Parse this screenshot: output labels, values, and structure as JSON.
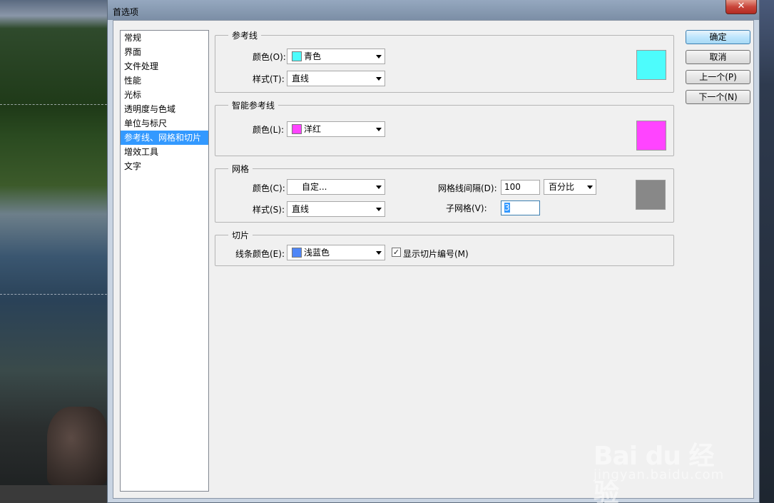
{
  "window": {
    "title": "首选项",
    "close_label": "✕"
  },
  "nav": {
    "items": [
      "常规",
      "界面",
      "文件处理",
      "性能",
      "光标",
      "透明度与色域",
      "单位与标尺",
      "参考线、网格和切片",
      "增效工具",
      "文字"
    ],
    "selected_index": 7
  },
  "guides": {
    "title": "参考线",
    "color_label": "颜色(O):",
    "color_value": "青色",
    "color_hex": "#4dfcfc",
    "style_label": "样式(T):",
    "style_value": "直线"
  },
  "smart_guides": {
    "title": "智能参考线",
    "color_label": "颜色(L):",
    "color_value": "洋红",
    "color_hex": "#ff44ff"
  },
  "grid": {
    "title": "网格",
    "color_label": "颜色(C):",
    "color_value": "自定...",
    "color_hex": "#888888",
    "style_label": "样式(S):",
    "style_value": "直线",
    "spacing_label": "网格线间隔(D):",
    "spacing_value": "100",
    "unit_value": "百分比",
    "subdiv_label": "子网格(V):",
    "subdiv_value": "3"
  },
  "slices": {
    "title": "切片",
    "line_color_label": "线条颜色(E):",
    "line_color_value": "浅蓝色",
    "line_color_hex": "#4f86f7",
    "show_numbers_label": "显示切片编号(M)",
    "show_numbers_checked": true,
    "check_mark": "✓"
  },
  "buttons": {
    "ok": "确定",
    "cancel": "取消",
    "prev": "上一个(P)",
    "next": "下一个(N)"
  },
  "watermark": {
    "logo": "Bai du 经验",
    "url": "jingyan.baidu.com"
  }
}
